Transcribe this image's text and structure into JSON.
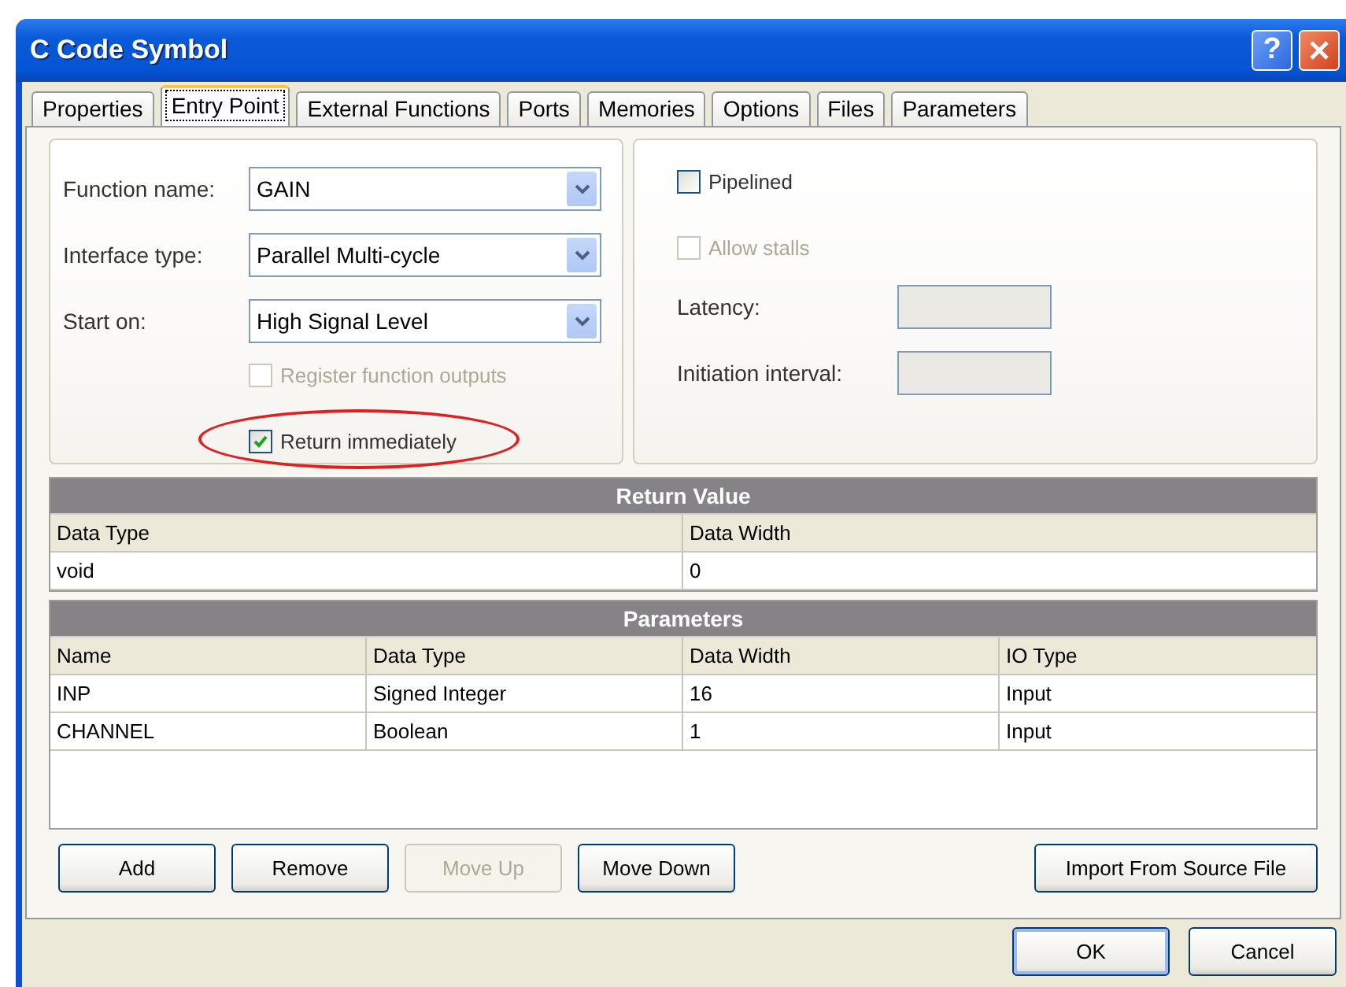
{
  "window": {
    "title": "C Code Symbol",
    "help_button": "?"
  },
  "tabs": [
    {
      "label": "Properties",
      "selected": false
    },
    {
      "label": "Entry Point",
      "selected": true
    },
    {
      "label": "External Functions",
      "selected": false
    },
    {
      "label": "Ports",
      "selected": false
    },
    {
      "label": "Memories",
      "selected": false
    },
    {
      "label": "Options",
      "selected": false
    },
    {
      "label": "Files",
      "selected": false
    },
    {
      "label": "Parameters",
      "selected": false
    }
  ],
  "entry_point": {
    "fields": [
      {
        "label": "Function name:",
        "value": "GAIN"
      },
      {
        "label": "Interface type:",
        "value": "Parallel Multi-cycle"
      },
      {
        "label": "Start on:",
        "value": "High Signal Level"
      }
    ],
    "options": [
      {
        "label": "Register function outputs",
        "checked": false,
        "disabled": true,
        "circled": false
      },
      {
        "label": "Return immediately",
        "checked": true,
        "disabled": false,
        "circled": true
      }
    ]
  },
  "pipeline": {
    "options": [
      {
        "label": "Pipelined",
        "checked": false,
        "disabled": false
      },
      {
        "label": "Allow stalls",
        "checked": false,
        "disabled": true
      }
    ],
    "inputs": [
      {
        "label": "Latency:",
        "disabled": true
      },
      {
        "label": "Initiation interval:",
        "disabled": true
      }
    ]
  },
  "return_value": {
    "title": "Return Value",
    "columns": [
      "Data Type",
      "Data Width"
    ],
    "rows": [
      [
        "void",
        "0"
      ]
    ]
  },
  "parameters": {
    "title": "Parameters",
    "columns": [
      "Name",
      "Data Type",
      "Data Width",
      "IO Type"
    ],
    "rows": [
      [
        "INP",
        "Signed Integer",
        "16",
        "Input"
      ],
      [
        "CHANNEL",
        "Boolean",
        "1",
        "Input"
      ]
    ]
  },
  "buttons": [
    {
      "label": "Add",
      "disabled": false
    },
    {
      "label": "Remove",
      "disabled": false
    },
    {
      "label": "Move Up",
      "disabled": true
    },
    {
      "label": "Move Down",
      "disabled": false
    },
    {
      "label": "Import From Source File",
      "disabled": false
    }
  ],
  "dialog_buttons": [
    {
      "label": "OK",
      "default": true
    },
    {
      "label": "Cancel",
      "default": false
    }
  ]
}
